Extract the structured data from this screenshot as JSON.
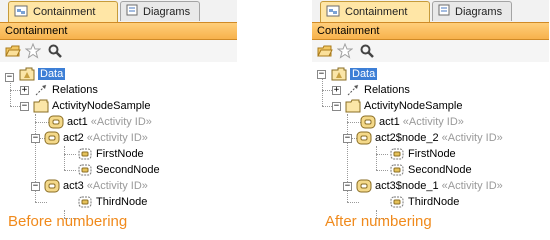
{
  "tabs": {
    "containment": "Containment",
    "diagrams": "Diagrams"
  },
  "panel_title": "Containment",
  "toolbar": {
    "icons": [
      "open-folder-icon",
      "star-icon",
      "search-icon"
    ]
  },
  "left": {
    "caption": "Before numbering",
    "tree": {
      "data": "Data",
      "relations": "Relations",
      "activity_node_sample": "ActivityNodeSample",
      "act1": "act1",
      "act1_stereo": "«Activity ID»",
      "act2": "act2",
      "act2_stereo": "«Activity ID»",
      "first_node": "FirstNode",
      "second_node": "SecondNode",
      "act3": "act3",
      "act3_stereo": "«Activity ID»",
      "third_node": "ThirdNode"
    }
  },
  "right": {
    "caption": "After numbering",
    "tree": {
      "data": "Data",
      "relations": "Relations",
      "activity_node_sample": "ActivityNodeSample",
      "act1": "act1",
      "act1_stereo": "«Activity ID»",
      "act2": "act2$node_2",
      "act2_stereo": "«Activity ID»",
      "first_node": "FirstNode",
      "second_node": "SecondNode",
      "act3": "act3$node_1",
      "act3_stereo": "«Activity ID»",
      "third_node": "ThirdNode"
    }
  },
  "colors": {
    "accent": "#f7b24c",
    "selection": "#3d7fd6",
    "caption": "#f08a1c",
    "stereotype": "#9a9a9a"
  }
}
